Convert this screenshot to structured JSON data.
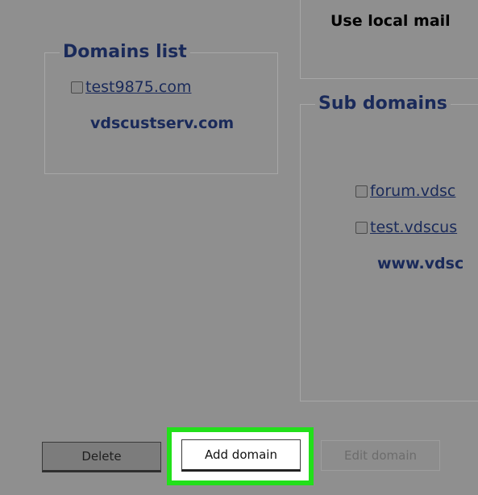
{
  "top_panel": {
    "label": "Use local mail"
  },
  "domains_list": {
    "legend": "Domains list",
    "items": [
      {
        "label": "test9875.com",
        "has_checkbox": true,
        "is_link": true
      },
      {
        "label": "vdscustserv.com",
        "has_checkbox": false,
        "is_link": false
      }
    ]
  },
  "sub_domains": {
    "legend": "Sub domains",
    "items": [
      {
        "label": "forum.vdsc",
        "has_checkbox": true,
        "is_link": true
      },
      {
        "label": "test.vdscus",
        "has_checkbox": true,
        "is_link": true
      },
      {
        "label": "www.vdsc",
        "has_checkbox": false,
        "is_link": false
      }
    ]
  },
  "buttons": {
    "delete": "Delete",
    "add_domain": "Add domain",
    "edit_domain": "Edit domain"
  },
  "colors": {
    "background": "#8f8f8f",
    "text_accent": "#1a2a5a",
    "highlight": "#22e01a"
  },
  "icons": {
    "checkbox": "checkbox-icon"
  }
}
